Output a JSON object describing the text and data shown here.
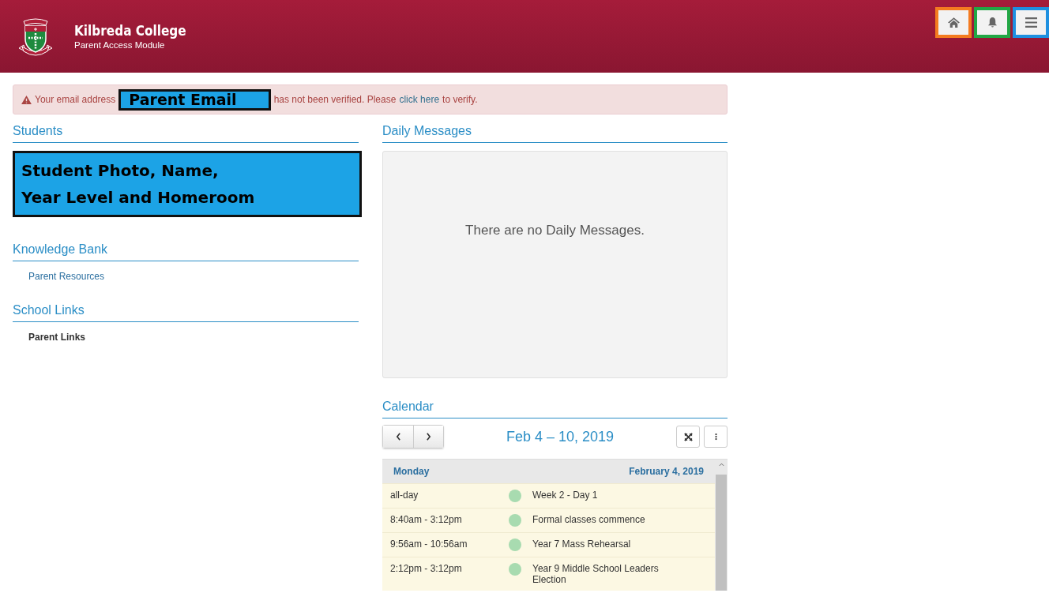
{
  "header": {
    "title": "Kilbreda College",
    "subtitle": "Parent Access Module",
    "buttons": [
      {
        "kind": "home",
        "color": "#f47b20"
      },
      {
        "kind": "bell",
        "color": "#22a745"
      },
      {
        "kind": "menu",
        "color": "#1e90e0"
      }
    ]
  },
  "alert": {
    "before": "Your email address",
    "redaction": "Parent Email",
    "after": "has not been verified. Please",
    "link": "click here",
    "end": "to verify."
  },
  "students": {
    "heading": "Students",
    "redaction_lines": [
      "Student Photo, Name,",
      "Year Level and Homeroom"
    ]
  },
  "knowledge_bank": {
    "heading": "Knowledge Bank",
    "links": [
      "Parent Resources"
    ]
  },
  "school_links": {
    "heading": "School Links",
    "links": [
      "Parent Links"
    ]
  },
  "daily_messages": {
    "heading": "Daily Messages",
    "empty_text": "There are no Daily Messages."
  },
  "calendar": {
    "heading": "Calendar",
    "range": "Feb 4 – 10, 2019",
    "day": "Monday",
    "date": "February 4, 2019",
    "events": [
      {
        "time": "all-day",
        "title": "Week 2 - Day 1",
        "color": "#a8dbb0"
      },
      {
        "time": "8:40am - 3:12pm",
        "title": "Formal classes commence",
        "color": "#a8dbb0"
      },
      {
        "time": "9:56am - 10:56am",
        "title": "Year 7 Mass Rehearsal",
        "color": "#a8dbb0"
      },
      {
        "time": "2:12pm - 3:12pm",
        "title": "Year 9 Middle School Leaders Election",
        "color": "#a8dbb0"
      }
    ]
  }
}
